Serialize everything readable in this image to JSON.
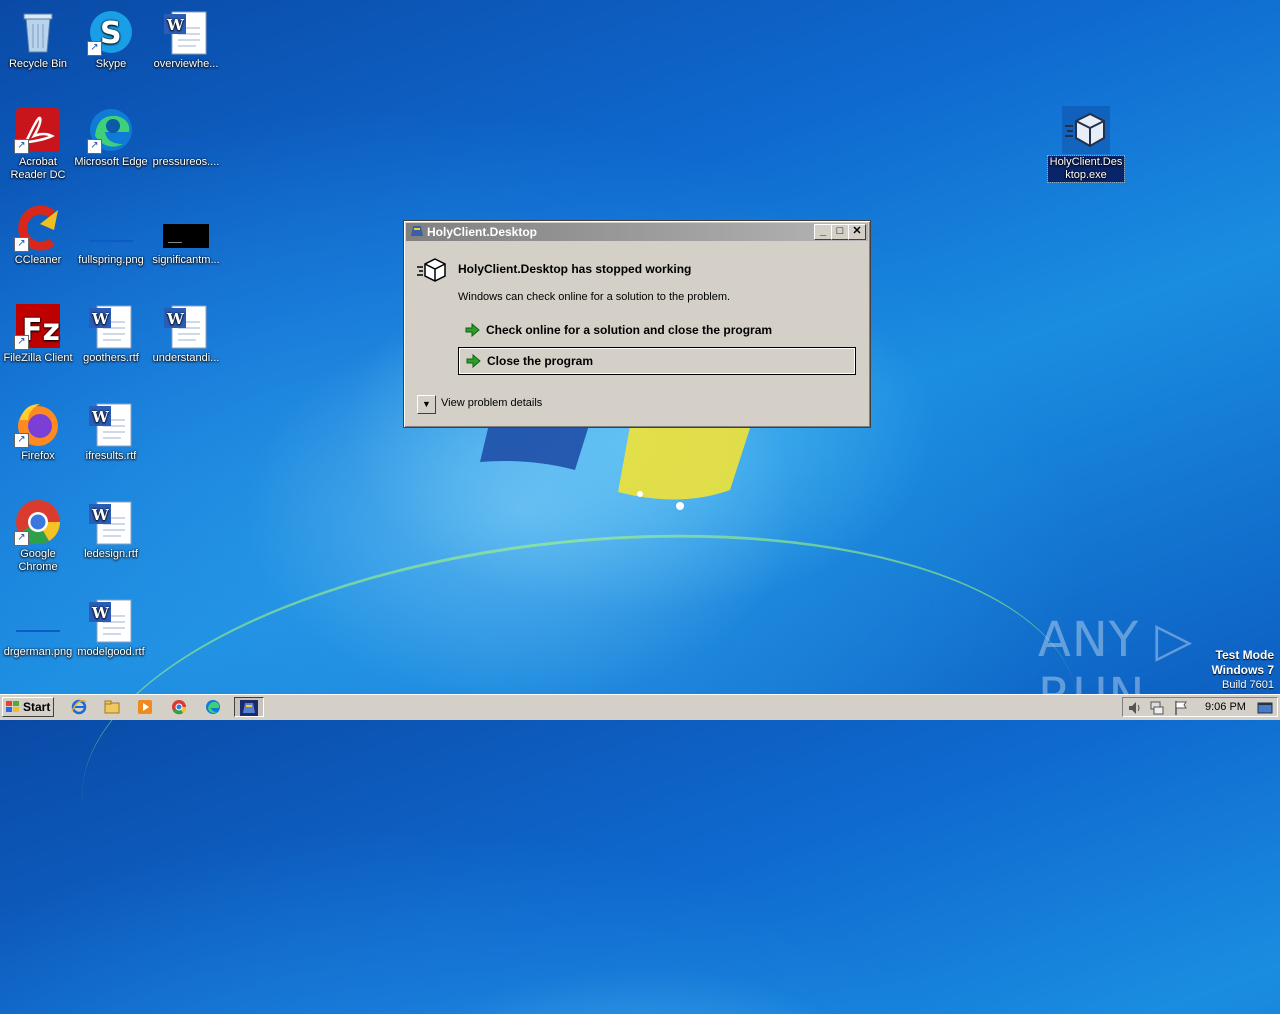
{
  "desktop": {
    "icons": [
      {
        "label": "Recycle Bin"
      },
      {
        "label": "Skype"
      },
      {
        "label": "overviewhe..."
      },
      {
        "label": "Acrobat Reader DC"
      },
      {
        "label": "Microsoft Edge"
      },
      {
        "label": "pressureos...."
      },
      {
        "label": "CCleaner"
      },
      {
        "label": "fullspring.png"
      },
      {
        "label": "significantm..."
      },
      {
        "label": "FileZilla Client"
      },
      {
        "label": "goothers.rtf"
      },
      {
        "label": "understandi..."
      },
      {
        "label": "Firefox"
      },
      {
        "label": "ifresults.rtf"
      },
      {
        "label": "Google Chrome"
      },
      {
        "label": "ledesign.rtf"
      },
      {
        "label": "drgerman.png"
      },
      {
        "label": "modelgood.rtf"
      },
      {
        "label": "HolyClient.Desktop.exe"
      }
    ]
  },
  "dialog": {
    "title": "HolyClient.Desktop",
    "heading": "HolyClient.Desktop has stopped working",
    "subtext": "Windows can check online for a solution to the problem.",
    "option_check_online": "Check online for a solution and close the program",
    "option_close": "Close the program",
    "details_label": "View problem details",
    "title_buttons": {
      "minimize": "_",
      "maximize": "□",
      "close": "✕"
    }
  },
  "watermark": {
    "brand": "ANY ▷ RUN",
    "mode": "Test Mode",
    "os": "Windows 7",
    "build": "Build 7601"
  },
  "taskbar": {
    "start_label": "Start",
    "items": [
      "ie-icon",
      "explorer-icon",
      "media-player-icon",
      "chrome-icon",
      "edge-icon",
      "holyclient-icon"
    ],
    "active_item": "holyclient-icon",
    "clock": "9:06 PM"
  },
  "colors": {
    "dialog_bg": "#d4d0c8",
    "titlebar_inactive": "#808080",
    "accent_green": "#2aa02a"
  }
}
